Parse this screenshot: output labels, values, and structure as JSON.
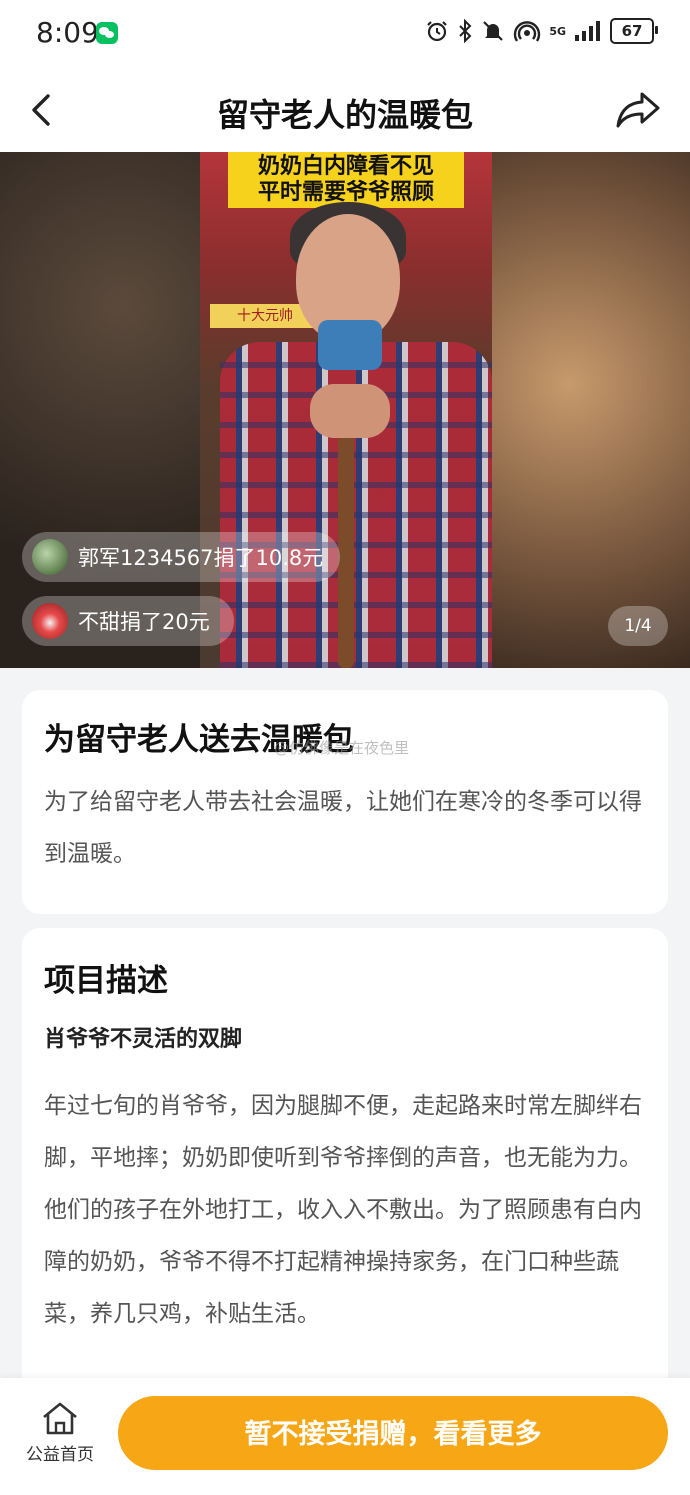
{
  "status_bar": {
    "time": "8:09",
    "signal_label": "5G",
    "battery": "67",
    "icons": [
      "wechat-icon",
      "alarm-icon",
      "bluetooth-icon",
      "mute-icon",
      "hotspot-icon",
      "signal-icon",
      "battery-icon"
    ]
  },
  "header": {
    "title": "留守老人的温暖包",
    "back_icon": "back-arrow-icon",
    "share_icon": "share-icon"
  },
  "hero": {
    "poster_text_line1": "奶奶白内障看不见",
    "poster_text_line2": "平时需要爷爷照顾",
    "poster_label": "十大元帅",
    "donors": [
      {
        "text": "郭军1234567捐了10.8元"
      },
      {
        "text": "不甜捐了20元"
      }
    ],
    "page_indicator": "1/4"
  },
  "intro": {
    "title": "为留守老人送去温暖包",
    "watermark": "@仿佛像是在夜色里",
    "body": "为了给留守老人带去社会温暖，让她们在寒冷的冬季可以得到温暖。"
  },
  "description": {
    "heading": "项目描述",
    "subheading": "肖爷爷不灵活的双脚",
    "body": "年过七旬的肖爷爷，因为腿脚不便，走起路来时常左脚绊右脚，平地摔；奶奶即使听到爷爷摔倒的声音，也无能为力。他们的孩子在外地打工，收入入不敷出。为了照顾患有白内障的奶奶，爷爷不得不打起精神操持家务，在门口种些蔬菜，养几只鸡，补贴生活。"
  },
  "bottom_bar": {
    "home_label": "公益首页",
    "home_icon": "home-icon",
    "donate_button": "暂不接受捐赠，看看更多"
  },
  "colors": {
    "accent": "#f7a716",
    "background": "#f3f4f6",
    "card": "#ffffff"
  }
}
